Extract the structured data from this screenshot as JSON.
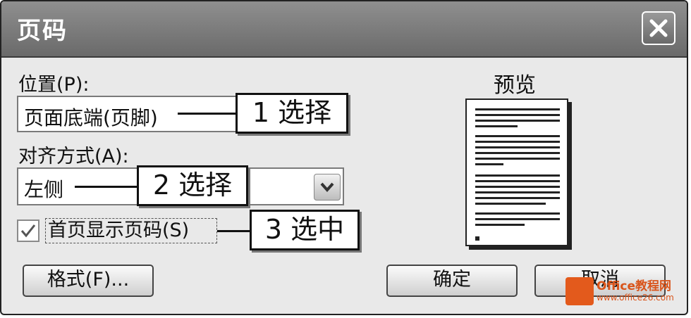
{
  "dialog": {
    "title": "页码",
    "close_icon": "close-x-icon"
  },
  "position": {
    "label": "位置(P):",
    "value": "页面底端(页脚)"
  },
  "alignment": {
    "label": "对齐方式(A):",
    "value": "左侧",
    "dropdown_icon": "chevron-down-icon"
  },
  "first_page": {
    "checked": true,
    "label": "首页显示页码(S)"
  },
  "preview": {
    "title": "预览"
  },
  "buttons": {
    "format": "格式(F)...",
    "ok": "确定",
    "cancel": "取消"
  },
  "callouts": {
    "step1": "1 选择",
    "step2": "2 选择",
    "step3": "3 选中"
  },
  "watermark": {
    "brand": "Office教程网",
    "url": "www.office26.com"
  },
  "colors": {
    "titlebar": "#7a7a7a",
    "dialog_bg": "#e9e9e9",
    "watermark": "#e35a1c"
  }
}
